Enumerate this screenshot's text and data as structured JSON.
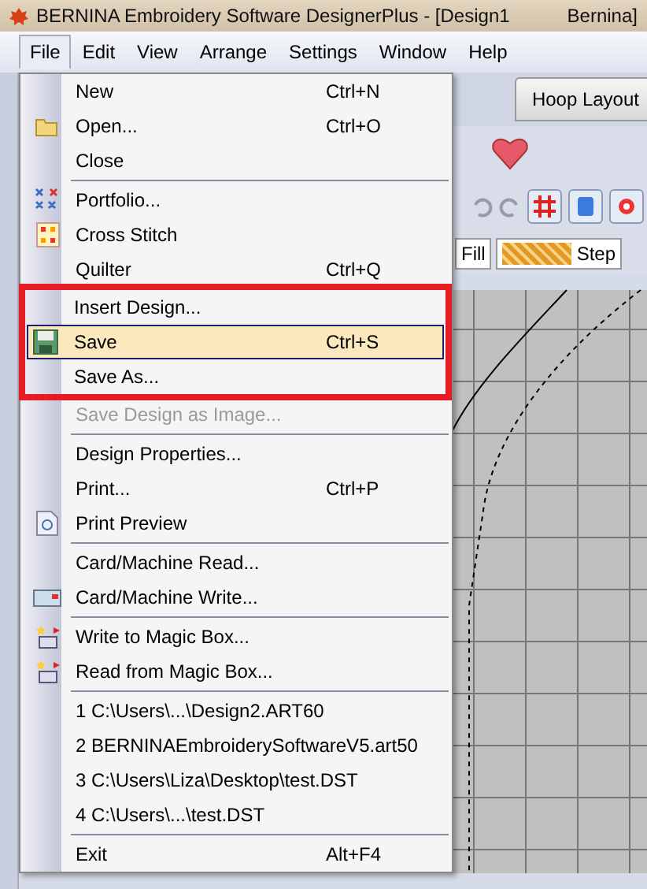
{
  "window": {
    "title": "BERNINA Embroidery Software DesignerPlus - [Design1",
    "title_tail": "Bernina]"
  },
  "menubar": [
    {
      "label": "File",
      "selected": true
    },
    {
      "label": "Edit",
      "selected": false
    },
    {
      "label": "View",
      "selected": false
    },
    {
      "label": "Arrange",
      "selected": false
    },
    {
      "label": "Settings",
      "selected": false
    },
    {
      "label": "Window",
      "selected": false
    },
    {
      "label": "Help",
      "selected": false
    }
  ],
  "toolbar": {
    "tab": "Hoop Layout",
    "stitch_types": [
      "Fill",
      "Step"
    ]
  },
  "menu": {
    "items": [
      {
        "kind": "item",
        "label": "New",
        "shortcut": "Ctrl+N",
        "selected": false,
        "disabled": false,
        "highlighted": false
      },
      {
        "kind": "item",
        "label": "Open...",
        "shortcut": "Ctrl+O",
        "selected": false,
        "disabled": false,
        "highlighted": false
      },
      {
        "kind": "item",
        "label": "Close",
        "selected": false,
        "disabled": false,
        "highlighted": false
      },
      {
        "kind": "separator"
      },
      {
        "kind": "item",
        "label": "Portfolio...",
        "selected": false,
        "disabled": false,
        "highlighted": false
      },
      {
        "kind": "item",
        "label": "Cross Stitch",
        "selected": false,
        "disabled": false,
        "highlighted": false
      },
      {
        "kind": "item",
        "label": "Quilter",
        "shortcut": "Ctrl+Q",
        "selected": false,
        "disabled": false,
        "highlighted": false
      },
      {
        "kind": "item",
        "label": "Insert Design...",
        "selected": false,
        "disabled": false,
        "highlighted": true
      },
      {
        "kind": "item",
        "label": "Save",
        "shortcut": "Ctrl+S",
        "selected": true,
        "disabled": false,
        "highlighted": true
      },
      {
        "kind": "item",
        "label": "Save As...",
        "selected": false,
        "disabled": false,
        "highlighted": true
      },
      {
        "kind": "item",
        "label": "Save Design as Image...",
        "selected": false,
        "disabled": true,
        "highlighted": false
      },
      {
        "kind": "separator"
      },
      {
        "kind": "item",
        "label": "Design Properties...",
        "selected": false,
        "disabled": false,
        "highlighted": false
      },
      {
        "kind": "item",
        "label": "Print...",
        "shortcut": "Ctrl+P",
        "selected": false,
        "disabled": false,
        "highlighted": false
      },
      {
        "kind": "item",
        "label": "Print Preview",
        "selected": false,
        "disabled": false,
        "highlighted": false
      },
      {
        "kind": "separator"
      },
      {
        "kind": "item",
        "label": "Card/Machine Read...",
        "selected": false,
        "disabled": false,
        "highlighted": false
      },
      {
        "kind": "item",
        "label": "Card/Machine Write...",
        "selected": false,
        "disabled": false,
        "highlighted": false
      },
      {
        "kind": "separator"
      },
      {
        "kind": "item",
        "label": "Write to Magic Box...",
        "selected": false,
        "disabled": false,
        "highlighted": false
      },
      {
        "kind": "item",
        "label": "Read from Magic Box...",
        "selected": false,
        "disabled": false,
        "highlighted": false
      },
      {
        "kind": "separator"
      },
      {
        "kind": "item",
        "label": "1 C:\\Users\\...\\Design2.ART60",
        "selected": false,
        "disabled": false,
        "highlighted": false
      },
      {
        "kind": "item",
        "label": "2 BERNINAEmbroiderySoftwareV5.art50",
        "selected": false,
        "disabled": false,
        "highlighted": false
      },
      {
        "kind": "item",
        "label": "3 C:\\Users\\Liza\\Desktop\\test.DST",
        "selected": false,
        "disabled": false,
        "highlighted": false
      },
      {
        "kind": "item",
        "label": "4 C:\\Users\\...\\test.DST",
        "selected": false,
        "disabled": false,
        "highlighted": false
      },
      {
        "kind": "separator"
      },
      {
        "kind": "item",
        "label": "Exit",
        "shortcut": "Alt+F4",
        "selected": false,
        "disabled": false,
        "highlighted": false
      }
    ]
  }
}
